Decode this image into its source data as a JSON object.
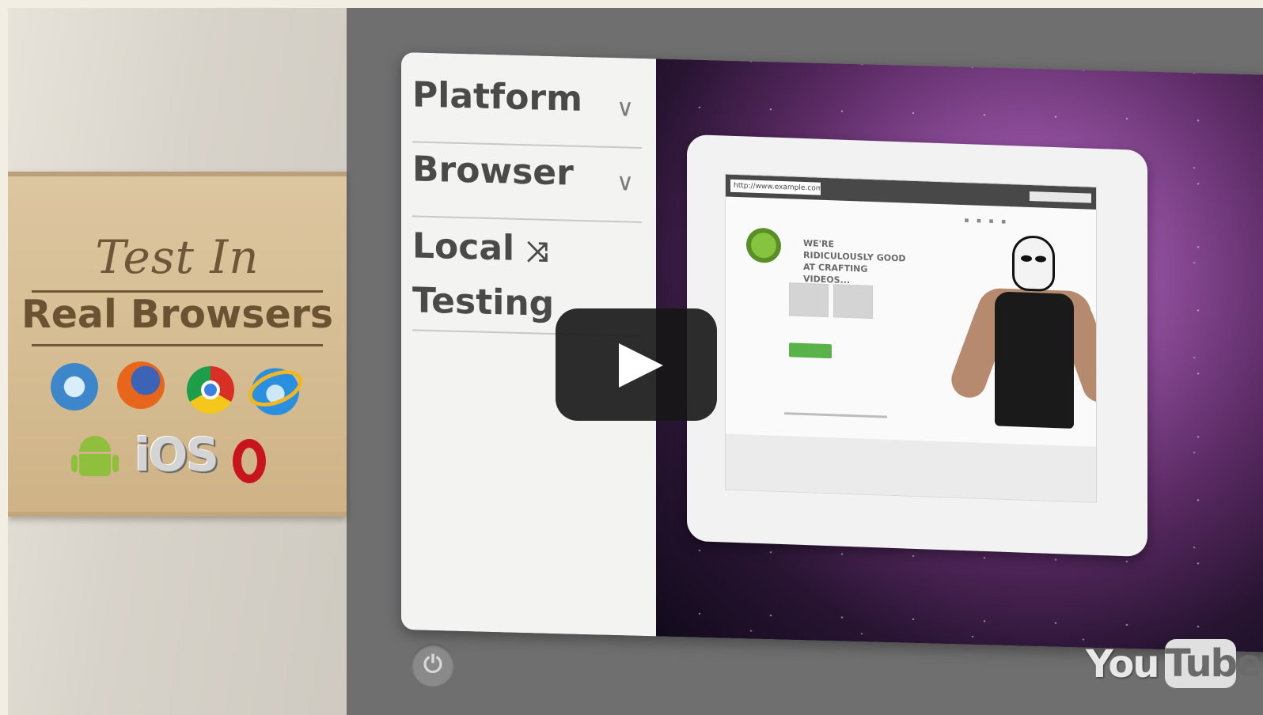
{
  "left_panel": {
    "heading_script": "Test In",
    "heading_main": "Real Browsers",
    "browser_icons": [
      "safari-icon",
      "firefox-icon",
      "chrome-icon",
      "internet-explorer-icon"
    ],
    "platform_icons": [
      "android-icon",
      "ios-logo",
      "opera-icon"
    ],
    "ios_label": "iOS"
  },
  "menu": {
    "items": [
      {
        "label": "Platform",
        "icon": "chevron-down-icon"
      },
      {
        "label": "Browser",
        "icon": "chevron-down-icon"
      },
      {
        "label_line1": "Local",
        "label_line2": "Testing",
        "icon": "shuffle-icon"
      }
    ]
  },
  "tablet": {
    "url": "http://www.example.com",
    "tagline": "WE'RE RIDICULOUSLY GOOD AT CRAFTING VIDEOS..."
  },
  "player": {
    "play_icon": "play-icon",
    "power_icon": "power-icon",
    "brand": {
      "you": "You",
      "tube": "Tube"
    }
  },
  "colors": {
    "plank": "#d6bd93",
    "heading_text": "#6a5232",
    "menu_bg": "#f3f3f1",
    "play_bg": "#161616"
  }
}
